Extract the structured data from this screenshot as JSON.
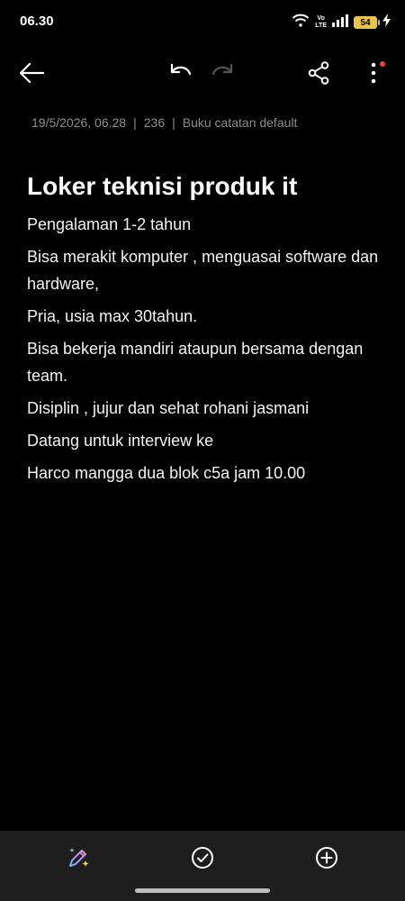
{
  "status_bar": {
    "time": "06.30",
    "volte_top": "Vo",
    "volte_bottom": "LTE",
    "battery": "54"
  },
  "toolbar": {
    "icons": [
      "back-arrow-icon",
      "undo-icon",
      "redo-icon",
      "share-icon",
      "more-vertical-icon"
    ],
    "redo_enabled": false,
    "notification_dot_color": "#e5483c"
  },
  "meta": {
    "date": "19/5/2026, 06.28",
    "separator": "|",
    "char_count": "236",
    "notebook": "Buku catatan default"
  },
  "note": {
    "title": "Loker teknisi produk it",
    "lines": [
      "Pengalaman 1-2 tahun",
      "Bisa merakit komputer , menguasai software dan hardware,",
      "Pria, usia max 30tahun.",
      "Bisa bekerja mandiri ataupun bersama dengan team.",
      "Disiplin , jujur dan sehat rohani jasmani",
      "Datang untuk interview ke",
      "Harco mangga dua blok c5a jam 10.00"
    ]
  },
  "bottom_bar": {
    "icons": [
      "ai-pen-icon",
      "checklist-icon",
      "add-circle-icon"
    ],
    "background": "#1e1e1e"
  },
  "colors": {
    "background": "#000000",
    "text": "#ffffff",
    "meta_text": "#8e8e8e",
    "battery": "#e8c547"
  }
}
